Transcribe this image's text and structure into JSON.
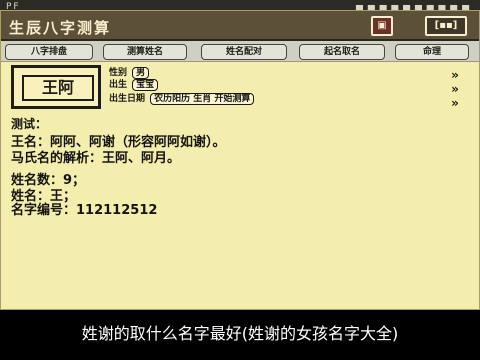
{
  "status_bar": {
    "left": "PF",
    "right": "▄ ▄ ▄ ▄ ▄ ▄ ▄ ▄ ▄ ▄"
  },
  "app": {
    "title": "生辰八字测算"
  },
  "title_buttons": {
    "btn_a": "▣",
    "btn_b": "[▪▪]"
  },
  "tabs": [
    "八字排盘",
    "测算姓名",
    "姓名配对",
    "起名取名",
    "命理"
  ],
  "avatar": {
    "label": "王阿"
  },
  "fields": [
    {
      "label": "性别",
      "value": "男"
    },
    {
      "label": "出生",
      "value": "宝宝"
    },
    {
      "label": "出生日期",
      "value": "农历阳历 生肖 开始测算"
    }
  ],
  "arrows": [
    "»",
    "»",
    "»"
  ],
  "text_lines": [
    "测试：",
    "王名：阿阿、阿谢（形容阿阿如谢）。",
    "马氏名的解析：王阿、阿月。",
    "姓名数：9；",
    "姓名：王；",
    "名字编号：112112512"
  ],
  "caption": "姓谢的取什么名字最好(姓谢的女孩名字大全)"
}
